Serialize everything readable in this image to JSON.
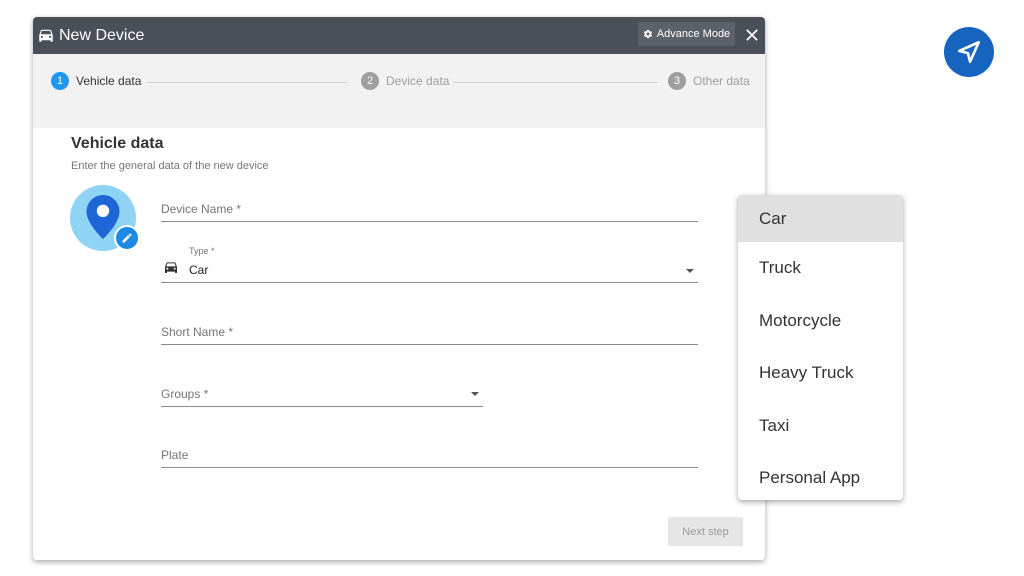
{
  "window": {
    "title": "New Device",
    "advance_mode_label": "Advance Mode"
  },
  "stepper": {
    "steps": [
      {
        "number": "1",
        "label": "Vehicle data",
        "active": true
      },
      {
        "number": "2",
        "label": "Device data",
        "active": false
      },
      {
        "number": "3",
        "label": "Other data",
        "active": false
      }
    ]
  },
  "section": {
    "title": "Vehicle data",
    "subtitle": "Enter the general data of the new device"
  },
  "form": {
    "device_name": {
      "label": "Device Name *",
      "value": ""
    },
    "type": {
      "label": "Type *",
      "value": "Car"
    },
    "short_name": {
      "label": "Short Name *",
      "value": ""
    },
    "groups": {
      "label": "Groups *",
      "value": ""
    },
    "plate": {
      "label": "Plate",
      "value": ""
    }
  },
  "next_step_label": "Next step",
  "type_dropdown": {
    "options": [
      "Car",
      "Truck",
      "Motorcycle",
      "Heavy Truck",
      "Taxi",
      "Personal App"
    ],
    "selected": "Car"
  },
  "colors": {
    "titlebar": "#4a5058",
    "accent": "#2196f3",
    "avatar_bg": "#8fd4f5",
    "nav_badge": "#1565c0"
  },
  "icons": {
    "title": "car-icon",
    "advance_mode": "gear-icon",
    "close": "close-icon",
    "avatar": "map-pin-icon",
    "avatar_edit": "pencil-icon",
    "type_field": "car-icon",
    "nav_badge": "navigation-arrow-icon"
  }
}
